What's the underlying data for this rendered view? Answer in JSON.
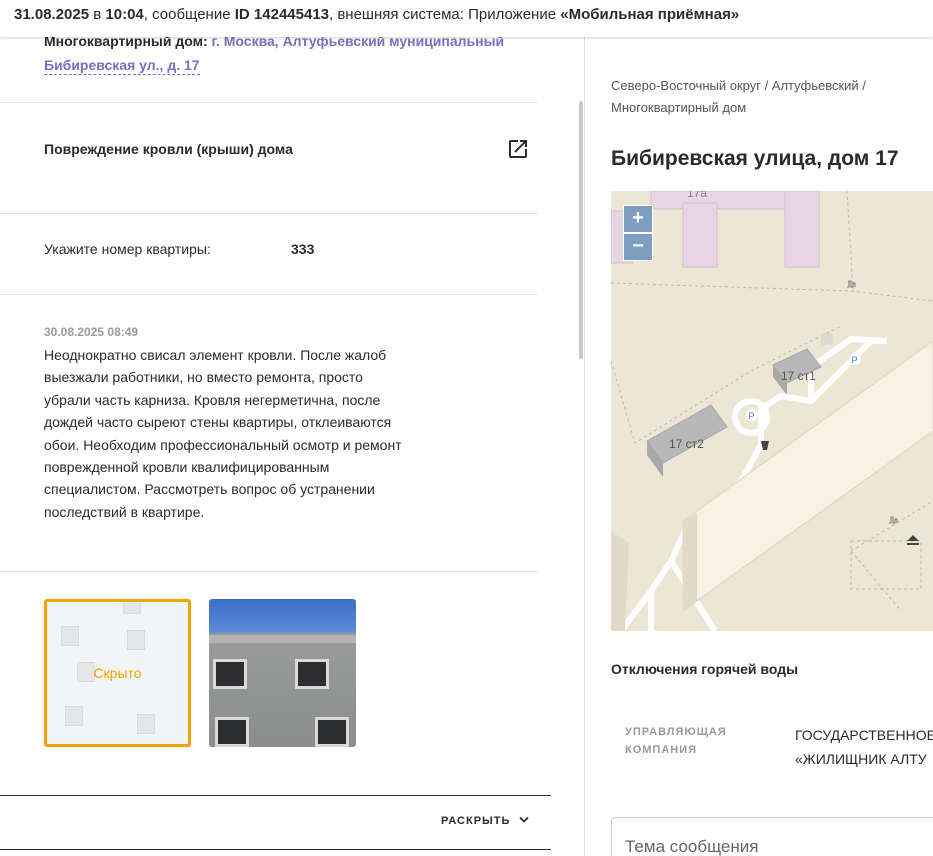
{
  "topbar": {
    "date": "31.08.2025",
    "in": "в",
    "time": "10:04",
    "message_prefix": ", сообщение",
    "id_label": "ID 142445413",
    "external_system": ", внешняя система: Приложение",
    "app_name": "«Мобильная приёмная»"
  },
  "left": {
    "address_cut_label": "Многоквартирный дом:",
    "address_cut_link": "г. Москва, Алтуфьевский муниципальный",
    "address_link": "Бибиревская ул., д. 17",
    "problem_title": "Повреждение кровли (крыши) дома",
    "apartment_label": "Укажите номер квартиры:",
    "apartment_value": "333",
    "message_date": "30.08.2025 08:49",
    "message_text": "Неоднократно свисал элемент кровли. После жалоб выезжали работники, но вместо ремонта, просто убрали часть карниза. Кровля негерметична, после дождей часто сыреют стены квартиры, отклеиваются обои. Необходим профессиональный осмотр и ремонт поврежденной кровли квалифицированным специалистом. Рассмотреть вопрос об устранении последствий в квартире.",
    "photo_hidden_label": "Скрыто",
    "expand_label": "РАСКРЫТЬ"
  },
  "right": {
    "breadcrumb": "Северо-Восточный округ / Алтуфьевский / Многоквартирный дом",
    "street_title": "Бибиревская улица, дом 17",
    "map": {
      "zoom_in": "+",
      "zoom_out": "−",
      "labels": [
        "17а",
        "17 ст1",
        "17 ст2"
      ],
      "parking": "P"
    },
    "hot_water_title": "Отключения горячей воды",
    "management_label_1": "УПРАВЛЯЮЩАЯ",
    "management_label_2": "КОМПАНИЯ",
    "management_name_1": "ГОСУДАРСТВЕННОЕ",
    "management_name_2": "«ЖИЛИЩНИК АЛТУ",
    "subject_placeholder": "Тема сообщения"
  },
  "colors": {
    "accent_orange": "#f5a300",
    "link_purple": "#7a6fbf",
    "map_bg": "#ece6d5",
    "zoom_button": "#7d9ec0"
  }
}
